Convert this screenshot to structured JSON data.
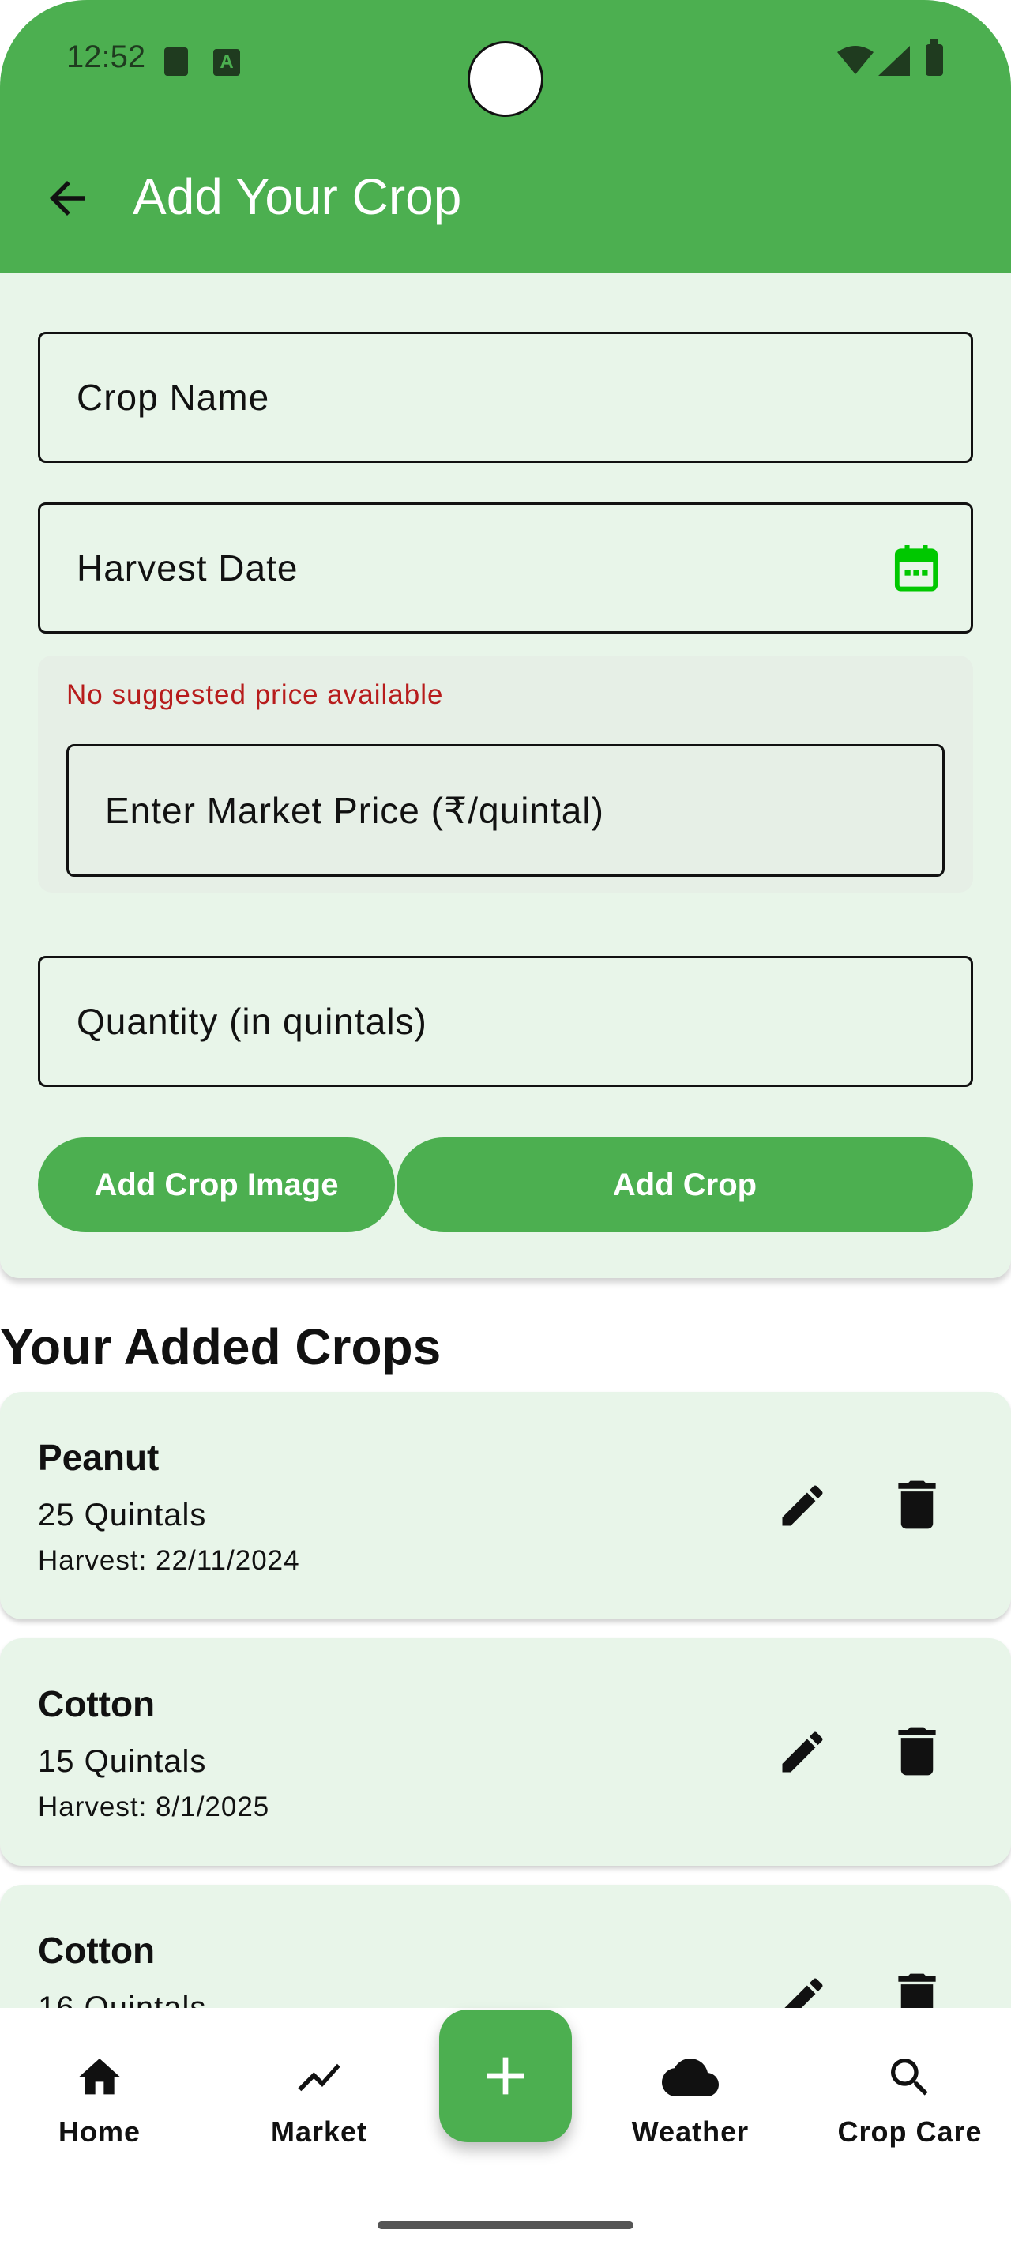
{
  "status_bar": {
    "time": "12:52"
  },
  "app_bar": {
    "title": "Add Your Crop"
  },
  "form": {
    "crop_name_placeholder": "Crop Name",
    "harvest_date_placeholder": "Harvest Date",
    "price_message": "No suggested price available",
    "market_price_placeholder": "Enter Market Price (₹/quintal)",
    "quantity_placeholder": "Quantity (in quintals)",
    "add_image_label": "Add Crop Image",
    "add_crop_label": "Add Crop"
  },
  "crops_section": {
    "title": "Your Added Crops",
    "items": [
      {
        "name": "Peanut",
        "quantity": "25 Quintals",
        "harvest": "Harvest: 22/11/2024"
      },
      {
        "name": "Cotton",
        "quantity": "15 Quintals",
        "harvest": "Harvest: 8/1/2025"
      },
      {
        "name": "Cotton",
        "quantity": "16 Quintals",
        "harvest": ""
      }
    ]
  },
  "bottom_nav": {
    "items": [
      {
        "label": "Home",
        "icon": "home-icon"
      },
      {
        "label": "Market",
        "icon": "trend-icon"
      },
      {
        "label": "Weather",
        "icon": "cloud-icon"
      },
      {
        "label": "Crop Care",
        "icon": "search-icon"
      }
    ],
    "fab_icon": "plus-icon"
  },
  "colors": {
    "primary": "#4caf50",
    "card_bg": "#e8f5e9",
    "error_text": "#b71c1c",
    "calendar_icon": "#00c800"
  }
}
